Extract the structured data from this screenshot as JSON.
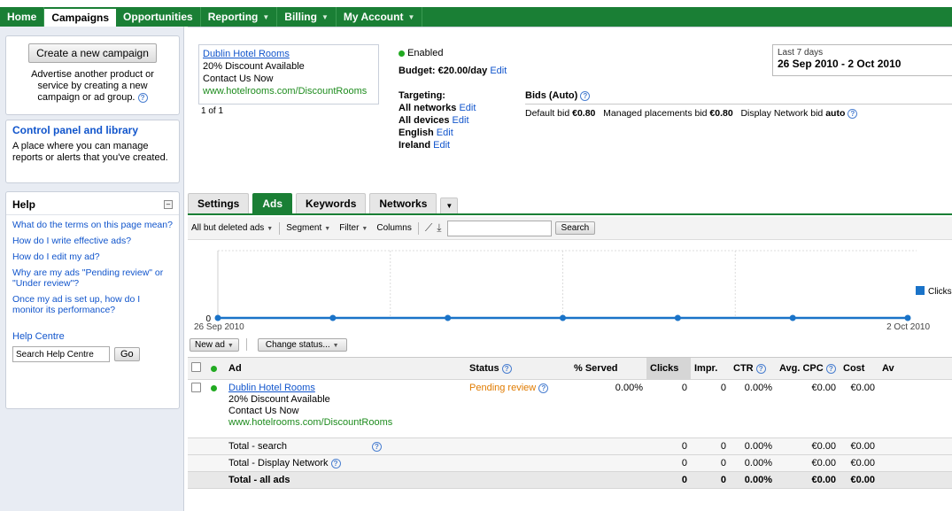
{
  "nav": {
    "items": [
      {
        "label": "Home",
        "caret": false,
        "active": false
      },
      {
        "label": "Campaigns",
        "caret": false,
        "active": true
      },
      {
        "label": "Opportunities",
        "caret": false,
        "active": false
      },
      {
        "label": "Reporting",
        "caret": true,
        "active": false
      },
      {
        "label": "Billing",
        "caret": true,
        "active": false
      },
      {
        "label": "My Account",
        "caret": true,
        "active": false
      }
    ]
  },
  "sidebar": {
    "create_button": "Create a new campaign",
    "create_desc": "Advertise another product or service by creating a new campaign or ad group.",
    "control_title": "Control panel and library",
    "control_desc": "A place where you can manage reports or alerts that you've created.",
    "help_title": "Help",
    "help_links": [
      "What do the terms on this page mean?",
      "How do I write effective ads?",
      "How do I edit my ad?",
      "Why are my ads \"Pending review\" or \"Under review\"?",
      "Once my ad is set up, how do I monitor its performance?"
    ],
    "help_centre": "Help Centre",
    "search_placeholder": "Search Help Centre",
    "go_button": "Go"
  },
  "ad_preview": {
    "headline": "Dublin Hotel Rooms",
    "line1": "20% Discount Available",
    "line2": "Contact Us Now",
    "url": "www.hotelrooms.com/DiscountRooms",
    "pager": "1 of 1"
  },
  "campaign": {
    "status": "Enabled",
    "budget_label": "Budget: €20.00/day",
    "edit": "Edit",
    "targeting_label": "Targeting:",
    "targeting": [
      "All networks",
      "All devices",
      "English",
      "Ireland"
    ],
    "bids_label": "Bids (Auto)",
    "bid_default_label": "Default bid",
    "bid_default_value": "€0.80",
    "bid_managed_label": "Managed placements bid",
    "bid_managed_value": "€0.80",
    "bid_display_label": "Display Network bid",
    "bid_display_value": "auto"
  },
  "date_range": {
    "label": "Last 7 days",
    "value": "26 Sep 2010 - 2 Oct 2010"
  },
  "tabs": [
    "Settings",
    "Ads",
    "Keywords",
    "Networks"
  ],
  "toolbar": {
    "filter_view": "All but deleted ads",
    "segment": "Segment",
    "filter": "Filter",
    "columns": "Columns",
    "search_button": "Search"
  },
  "chart_data": {
    "type": "line",
    "x": [
      "26 Sep 2010",
      "27 Sep 2010",
      "28 Sep 2010",
      "29 Sep 2010",
      "30 Sep 2010",
      "1 Oct 2010",
      "2 Oct 2010"
    ],
    "series": [
      {
        "name": "Clicks",
        "values": [
          0,
          0,
          0,
          0,
          0,
          0,
          0
        ]
      }
    ],
    "x_start_label": "26 Sep 2010",
    "x_end_label": "2 Oct 2010",
    "y_tick": "0",
    "ylim": [
      0,
      1
    ],
    "color": "#1a73c8",
    "grid": true
  },
  "actions": {
    "new_ad": "New ad",
    "change_status": "Change status..."
  },
  "table": {
    "headers": [
      "Ad",
      "Status",
      "% Served",
      "Clicks",
      "Impr.",
      "CTR",
      "Avg. CPC",
      "Cost",
      "Av"
    ],
    "ad_row": {
      "headline": "Dublin Hotel Rooms",
      "line1": "20% Discount Available",
      "line2": "Contact Us Now",
      "url": "www.hotelrooms.com/DiscountRooms",
      "status": "Pending review",
      "served": "0.00%",
      "clicks": "0",
      "impr": "0",
      "ctr": "0.00%",
      "cpc": "€0.00",
      "cost": "€0.00"
    },
    "totals": [
      {
        "label": "Total - search",
        "clicks": "0",
        "impr": "0",
        "ctr": "0.00%",
        "cpc": "€0.00",
        "cost": "€0.00"
      },
      {
        "label": "Total - Display Network",
        "clicks": "0",
        "impr": "0",
        "ctr": "0.00%",
        "cpc": "€0.00",
        "cost": "€0.00"
      },
      {
        "label": "Total - all ads",
        "clicks": "0",
        "impr": "0",
        "ctr": "0.00%",
        "cpc": "€0.00",
        "cost": "€0.00"
      }
    ]
  }
}
